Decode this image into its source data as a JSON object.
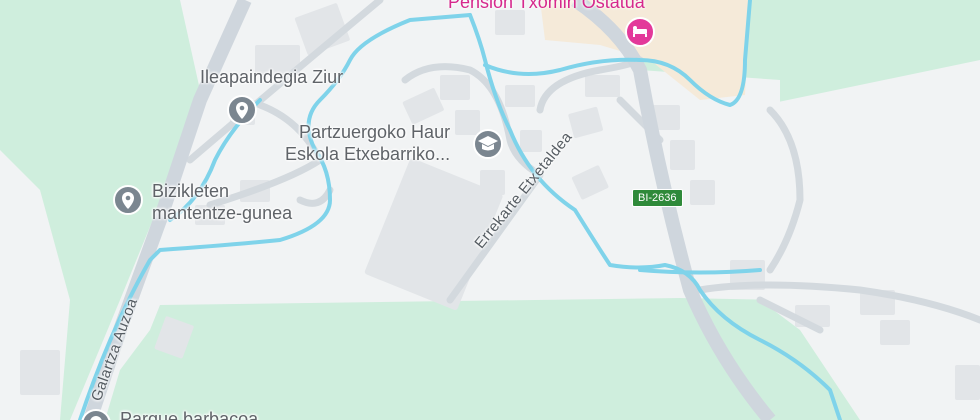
{
  "map": {
    "colors": {
      "background_green": "#cfeedd",
      "urban_gray": "#f1f3f4",
      "building": "#e2e5e8",
      "road": "#cfd6dd",
      "water": "#7fd3ea",
      "hotel_area": "#f5ead9",
      "poi_gray": "#7b8690",
      "hotel_pin": "#e3399a",
      "shield_green": "#2f8a3a"
    },
    "pois": [
      {
        "id": "ileapaindegia",
        "label_line1": "Ileapaindegia Ziur",
        "label_line2": "",
        "icon": "pin-generic-icon"
      },
      {
        "id": "haur-eskola",
        "label_line1": "Partzuergoko Haur",
        "label_line2": "Eskola Etxebarriko...",
        "icon": "school-cap-icon"
      },
      {
        "id": "bizikleten",
        "label_line1": "Bizikleten",
        "label_line2": "mantentze-gunea",
        "icon": "pin-generic-icon"
      },
      {
        "id": "parque",
        "label_line1": "Parque barbacoa",
        "label_line2": "",
        "icon": "pin-generic-icon"
      }
    ],
    "hotel": {
      "label": "Pension Txomin Ostatua",
      "icon": "bed-icon"
    },
    "streets": [
      {
        "id": "errekarte",
        "name": "Errekarte Etxetaldea"
      },
      {
        "id": "galartza",
        "name": "Galartza Auzoa"
      }
    ],
    "road_shield": "BI-2636"
  }
}
